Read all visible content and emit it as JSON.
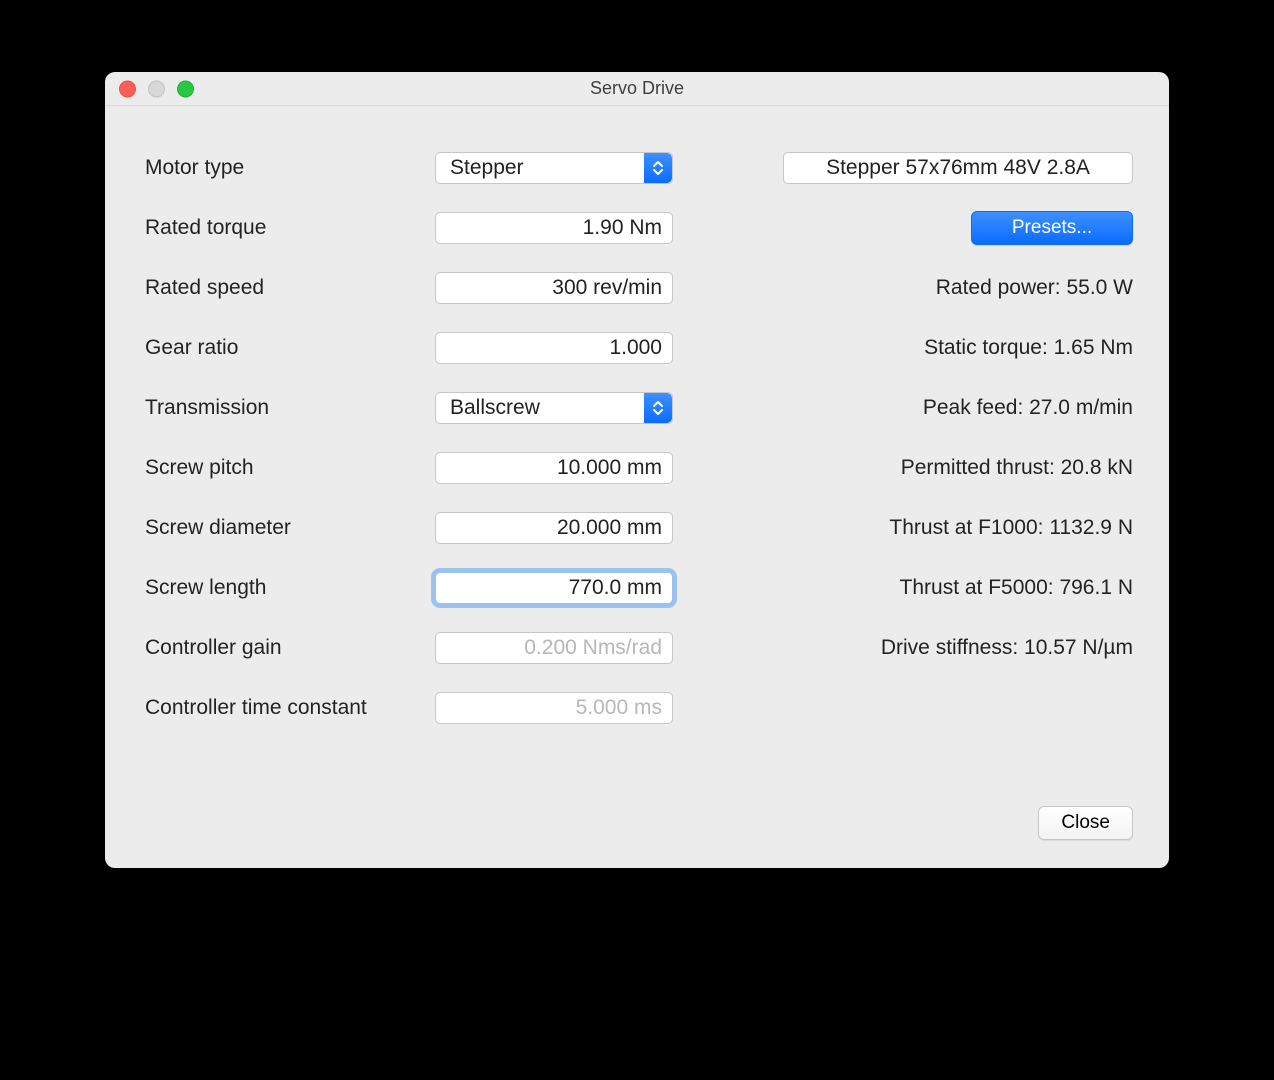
{
  "window": {
    "title": "Servo Drive"
  },
  "labels": {
    "motor_type": "Motor type",
    "rated_torque": "Rated torque",
    "rated_speed": "Rated speed",
    "gear_ratio": "Gear ratio",
    "transmission": "Transmission",
    "screw_pitch": "Screw pitch",
    "screw_diameter": "Screw diameter",
    "screw_length": "Screw length",
    "controller_gain": "Controller gain",
    "controller_tc": "Controller time constant"
  },
  "values": {
    "motor_type": "Stepper",
    "motor_preset": "Stepper 57x76mm 48V 2.8A",
    "rated_torque": "1.90 Nm",
    "rated_speed": "300 rev/min",
    "gear_ratio": "1.000",
    "transmission": "Ballscrew",
    "screw_pitch": "10.000 mm",
    "screw_diameter": "20.000 mm",
    "screw_length": "770.0 mm",
    "controller_gain": "0.200 Nms/rad",
    "controller_tc": "5.000 ms"
  },
  "computed": {
    "rated_power": "Rated power: 55.0 W",
    "static_torque": "Static torque: 1.65 Nm",
    "peak_feed": "Peak feed: 27.0 m/min",
    "permitted_thrust": "Permitted thrust: 20.8 kN",
    "thrust_f1000": "Thrust at F1000: 1132.9 N",
    "thrust_f5000": "Thrust at F5000: 796.1 N",
    "drive_stiffness": "Drive stiffness: 10.57 N/µm"
  },
  "buttons": {
    "presets": "Presets...",
    "close": "Close"
  }
}
